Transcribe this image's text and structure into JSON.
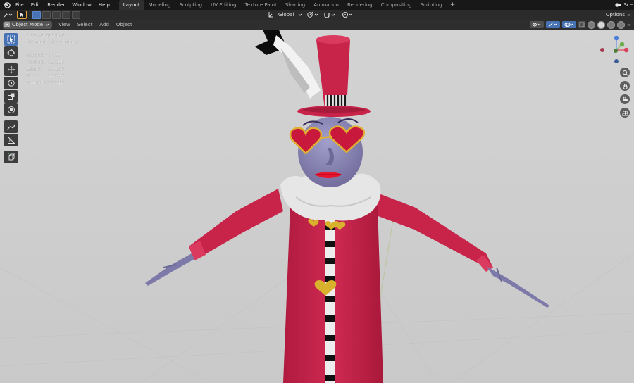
{
  "menu": {
    "items": [
      "File",
      "Edit",
      "Render",
      "Window",
      "Help"
    ]
  },
  "workspaces": {
    "tabs": [
      "Layout",
      "Modeling",
      "Sculpting",
      "UV Editing",
      "Texture Paint",
      "Shading",
      "Animation",
      "Rendering",
      "Compositing",
      "Scripting"
    ],
    "active": "Layout",
    "add": "+"
  },
  "scene": {
    "label": "Sce"
  },
  "tool_header": {
    "orientation": "Global",
    "options": "Options"
  },
  "viewport_header": {
    "mode": "Object Mode",
    "menus": [
      "View",
      "Select",
      "Add",
      "Object"
    ]
  },
  "overlay": {
    "view_name": "User Perspective",
    "collection": "(1) 5.8.8 | Head_Object"
  },
  "stats": [
    {
      "key": "Objects",
      "value": "0 / 35"
    },
    {
      "key": "Vertices",
      "value": "13,266"
    },
    {
      "key": "Edges",
      "value": "26,124"
    },
    {
      "key": "Faces",
      "value": "12,947"
    },
    {
      "key": "Triangles",
      "value": "26,212"
    }
  ],
  "colors": {
    "topbar": "#181818",
    "header": "#2b2b2b",
    "accent": "#4772b3",
    "viewport_bg": "#cfcfcf",
    "coat_red": "#c8244a",
    "face_purple": "#8c88b8"
  },
  "icons": {
    "toolbar": [
      "select-box-icon",
      "cursor-icon",
      "move-icon",
      "rotate-icon",
      "scale-icon",
      "transform-icon",
      "annotate-icon",
      "measure-icon",
      "add-cube-icon"
    ],
    "nav": [
      "zoom-icon",
      "hand-pan-icon",
      "camera-icon",
      "grid-persp-icon"
    ]
  }
}
